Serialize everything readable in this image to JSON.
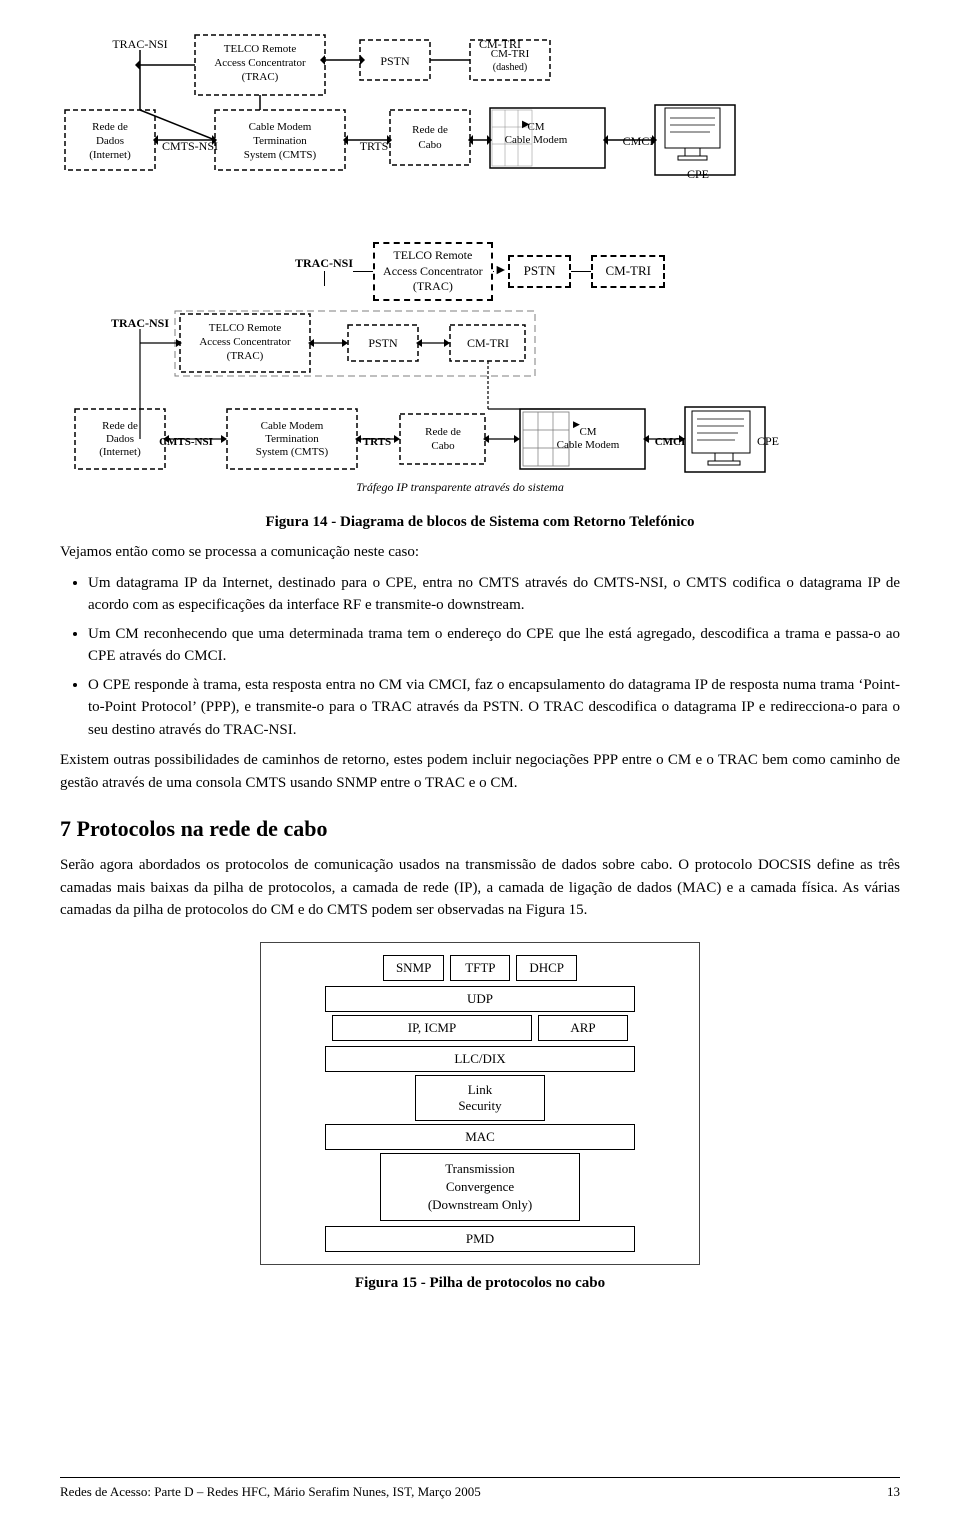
{
  "fig14": {
    "caption": "Figura 14 - Diagrama de blocos de Sistema com Retorno Telefónico",
    "label_traffic": "Tráfego IP transparente através do sistema",
    "nodes": {
      "trac_nsi": "TRAC-NSI",
      "telco": "TELCO Remote\nAccess Concentrator\n(TRAC)",
      "pstn": "PSTN",
      "cm_tri": "CM-TRI",
      "rede_dados": "Rede de\nDados\n(Internet)",
      "cmts_nsi": "CMTS-NSI",
      "cable_modem_term": "Cable Modem\nTermination\nSystem (CMTS)",
      "trts": "TRTS",
      "rede_cabo": "Rede de\nCabo",
      "cm": "CM\nCable Modem",
      "cmci": "CMCI",
      "cpe": "CPE"
    }
  },
  "body": {
    "intro": "Vejamos então como se processa a comunicação neste caso:",
    "bullet1": "Um datagrama IP da Internet, destinado para o CPE, entra no CMTS através do CMTS-NSI, o CMTS codifica o datagrama IP de acordo com as especificações da interface RF e transmite-o downstream.",
    "bullet2": "Um CM reconhecendo que uma determinada trama tem o endereço do CPE que lhe está agregado, descodifica a trama e passa-o ao CPE através do CMCI.",
    "bullet3_part1": "O CPE responde à trama, esta resposta entra no CM via CMCI, faz o encapsulamento do datagrama IP de resposta numa trama 'Point-to-Point Protocol' (PPP), e transmite-o para o TRAC através da PSTN.",
    "bullet3_part2": "O TRAC descodifica o datagrama IP e redirecciona-o para o seu destino através do TRAC-NSI.",
    "para_extra": "Existem outras possibilidades de caminhos de retorno, estes podem incluir negociações PPP entre o CM e o TRAC bem como caminho de gestão através de uma consola CMTS usando SNMP entre o TRAC e o CM."
  },
  "section7": {
    "heading": "7  Protocolos na rede de cabo",
    "para1": "Serão agora abordados os protocolos de comunicação usados na transmissão de dados sobre cabo. O protocolo DOCSIS define as três camadas mais baixas da pilha de protocolos, a camada de rede (IP), a camada de ligação de dados (MAC) e a camada física. As várias camadas da pilha de protocolos do CM e do CMTS podem ser observadas na Figura 15."
  },
  "fig15": {
    "caption": "Figura 15 - Pilha de protocolos no cabo",
    "layers": {
      "top_row": [
        "SNMP",
        "TFTP",
        "DHCP"
      ],
      "udp": "UDP",
      "ip_icmp": "IP, ICMP",
      "arp": "ARP",
      "llc_dix": "LLC/DIX",
      "link_security": "Link\nSecurity",
      "mac": "MAC",
      "transmission_convergence": "Transmission\nConvergence\n(Downstream Only)",
      "pmd": "PMD"
    }
  },
  "footer": {
    "left": "Redes de Acesso: Parte D – Redes HFC, Mário Serafim Nunes, IST, Março 2005",
    "right": "13"
  }
}
